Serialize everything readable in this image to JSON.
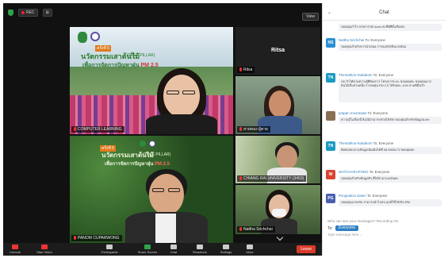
{
  "topbar": {
    "rec_label": "REC",
    "view_label": "View"
  },
  "tiles": {
    "t1": {
      "name": "COMPUTER LEARNING",
      "tag": "ครั้งที่ 5",
      "title": "นวัตกรรมเสาต้นไม้",
      "title_suffix": "(TREE PILLAR)",
      "subtitle_prefix": "เพื่อการจัดการปัญหาฝุ่น",
      "subtitle_em": "PM 2.5"
    },
    "t2": {
      "center_name": "Ritsa",
      "name": "Ritsa"
    },
    "t3": {
      "name": "สายทอง ผู้ตาย"
    },
    "t4": {
      "name": "PANOM CUPARWONG",
      "tag": "ครั้งที่ 5",
      "title": "นวัตกรรมเสาต้นไม้",
      "title_suffix": "(TREE PILLAR)",
      "subtitle_prefix": "เพื่อการจัดการปัญหาฝุ่น",
      "subtitle_em": "PM 2.5"
    },
    "t5": {
      "name": "CHIANG RAI UNIVERSITY (3453)"
    },
    "t6": {
      "name": "Nattha Srichchai"
    }
  },
  "toolbar": {
    "items": [
      "Unmute",
      "Start Video",
      "Participants",
      "Share Screen",
      "Chat",
      "Reactions",
      "Settings",
      "More"
    ],
    "leave": "Leave"
  },
  "chat": {
    "title": "Chat",
    "messages": [
      {
        "initials": "",
        "color": "#ffffff",
        "sender": "",
        "to": "",
        "text": "ขอบคุณกำไร บรรยากาศ Ucms ค่ะที่มีที่ตั้งเรื่องค่ะ"
      },
      {
        "initials": "NS",
        "color": "#2d8fd1",
        "sender": "Nattha Srichchai",
        "to": "To: Everyone",
        "text": "ขอบคุณสำหรับการนำเสนอ การอนุรักษ์สิ่งแวดล้อม"
      },
      {
        "initials": "TN",
        "color": "#1b9bc2",
        "sender": "Themathon Nuttakorn",
        "to": "To: Everyone",
        "text": "OK ถ้าได้ตามความรู้ที่ต้องการ โครงการระยะ ขอบคุณค่ะ ขอบคุณมาก ต้นไม้เป็นส่วนหนึ่ง การลดฝุ่น PM 2.5 ได้ร้อยละ 10% ตามที่ตั้งเป้า"
      },
      {
        "initials": "",
        "color": "#8a6f55",
        "sender": "prapan moorawan",
        "to": "To: Everyone",
        "text": "ความรู้ในเรื่องนี้ ต้นไม้สามารถช่วยได้จริง ขอบคุณสำหรับข้อมูลนะคะ"
      },
      {
        "initials": "TN",
        "color": "#1b9bc2",
        "sender": "Themathon Nuttakorn",
        "to": "To: Everyone",
        "text": "ติดต่อสอบถามข้อมูลเพิ่มเติมได้ที่ 08-5355173 ขอบคุณค่ะ"
      },
      {
        "initials": "W",
        "color": "#d9432f",
        "sender": "WATCHARAPONG",
        "to": "To: Everyone",
        "text": "ขอบคุณสำหรับข้อมูลดีๆ ที่ได้นำมาแบ่งปันค่ะ"
      },
      {
        "initials": "PG",
        "color": "#4a5fae",
        "sender": "Pongsakon Danin",
        "to": "To: Everyone",
        "text": "ขอบคุณมากครับ สามารถนำไปประยุกต์ใช้ได้จริง ครับ"
      }
    ],
    "note": "Who can see your messages? Recording On",
    "to_label": "To:",
    "to_value": "Everyone",
    "placeholder": "Type message here ..."
  }
}
